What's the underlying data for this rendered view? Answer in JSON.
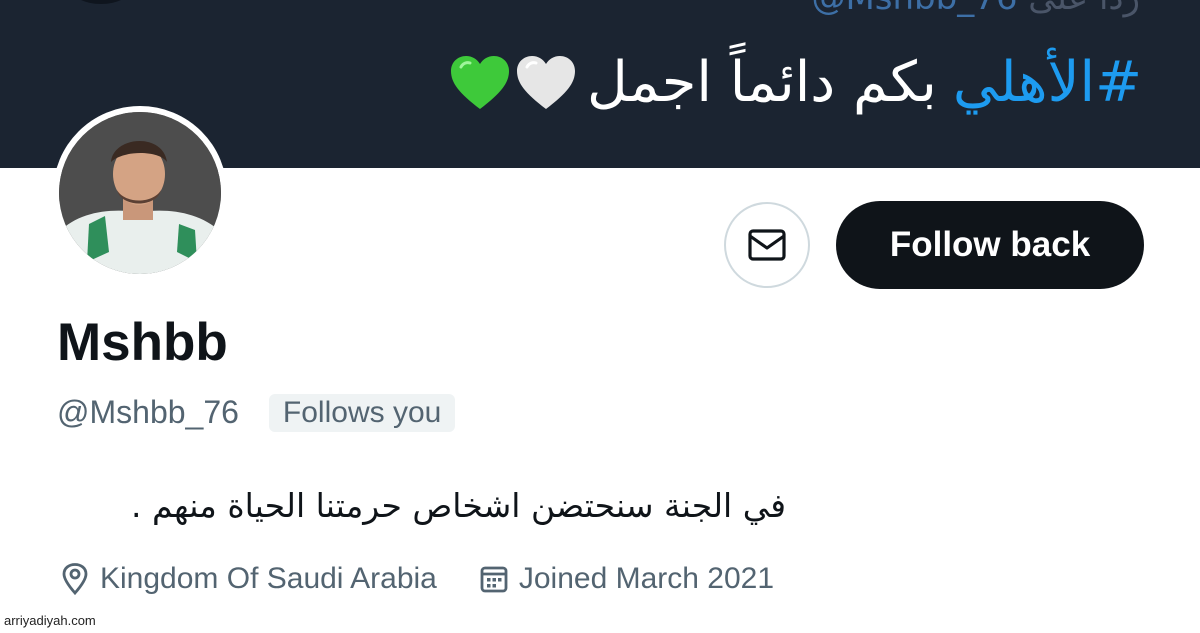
{
  "banner": {
    "reply_prefix": "ردا على",
    "reply_handle": "@Mshbb_76",
    "tweet_hashtag": "#الأهلي",
    "tweet_text": "بكم دائماً اجمل",
    "emoji_icons": [
      "white-heart-icon",
      "green-heart-icon"
    ],
    "colors": {
      "background": "#1b2431",
      "hashtag": "#1d9bf0",
      "green_heart": "#3ec93a",
      "white_heart": "#e6e6e6"
    }
  },
  "profile": {
    "avatar_icon": "avatar",
    "message_icon": "envelope-icon",
    "follow_button_label": "Follow back",
    "display_name": "Mshbb",
    "username": "@Mshbb_76",
    "follows_you_label": "Follows you",
    "bio": "في الجنة سنحتضن اشخاص حرمتنا الحياة منهم .",
    "location_icon": "location-pin-icon",
    "location": "Kingdom Of Saudi Arabia",
    "calendar_icon": "calendar-icon",
    "joined": "Joined March 2021",
    "colors": {
      "button_bg": "#0f1419",
      "secondary_text": "#536471",
      "badge_bg": "#eff3f4"
    }
  },
  "watermark": "arriyadiyah.com"
}
